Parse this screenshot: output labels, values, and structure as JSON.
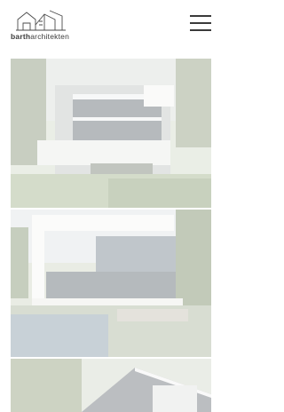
{
  "brand": {
    "name_bold": "barth",
    "name_light": "architekten"
  },
  "header": {
    "menu_icon": "hamburger-menu-icon"
  },
  "colors": {
    "background": "#ffffff",
    "text": "#3b3b3b",
    "image_overlay": "#ffffff"
  },
  "gallery": {
    "images": [
      {
        "subject": "glass-facade-house"
      },
      {
        "subject": "white-cube-villa-with-pool"
      },
      {
        "subject": "house-roof-with-tree"
      }
    ]
  }
}
